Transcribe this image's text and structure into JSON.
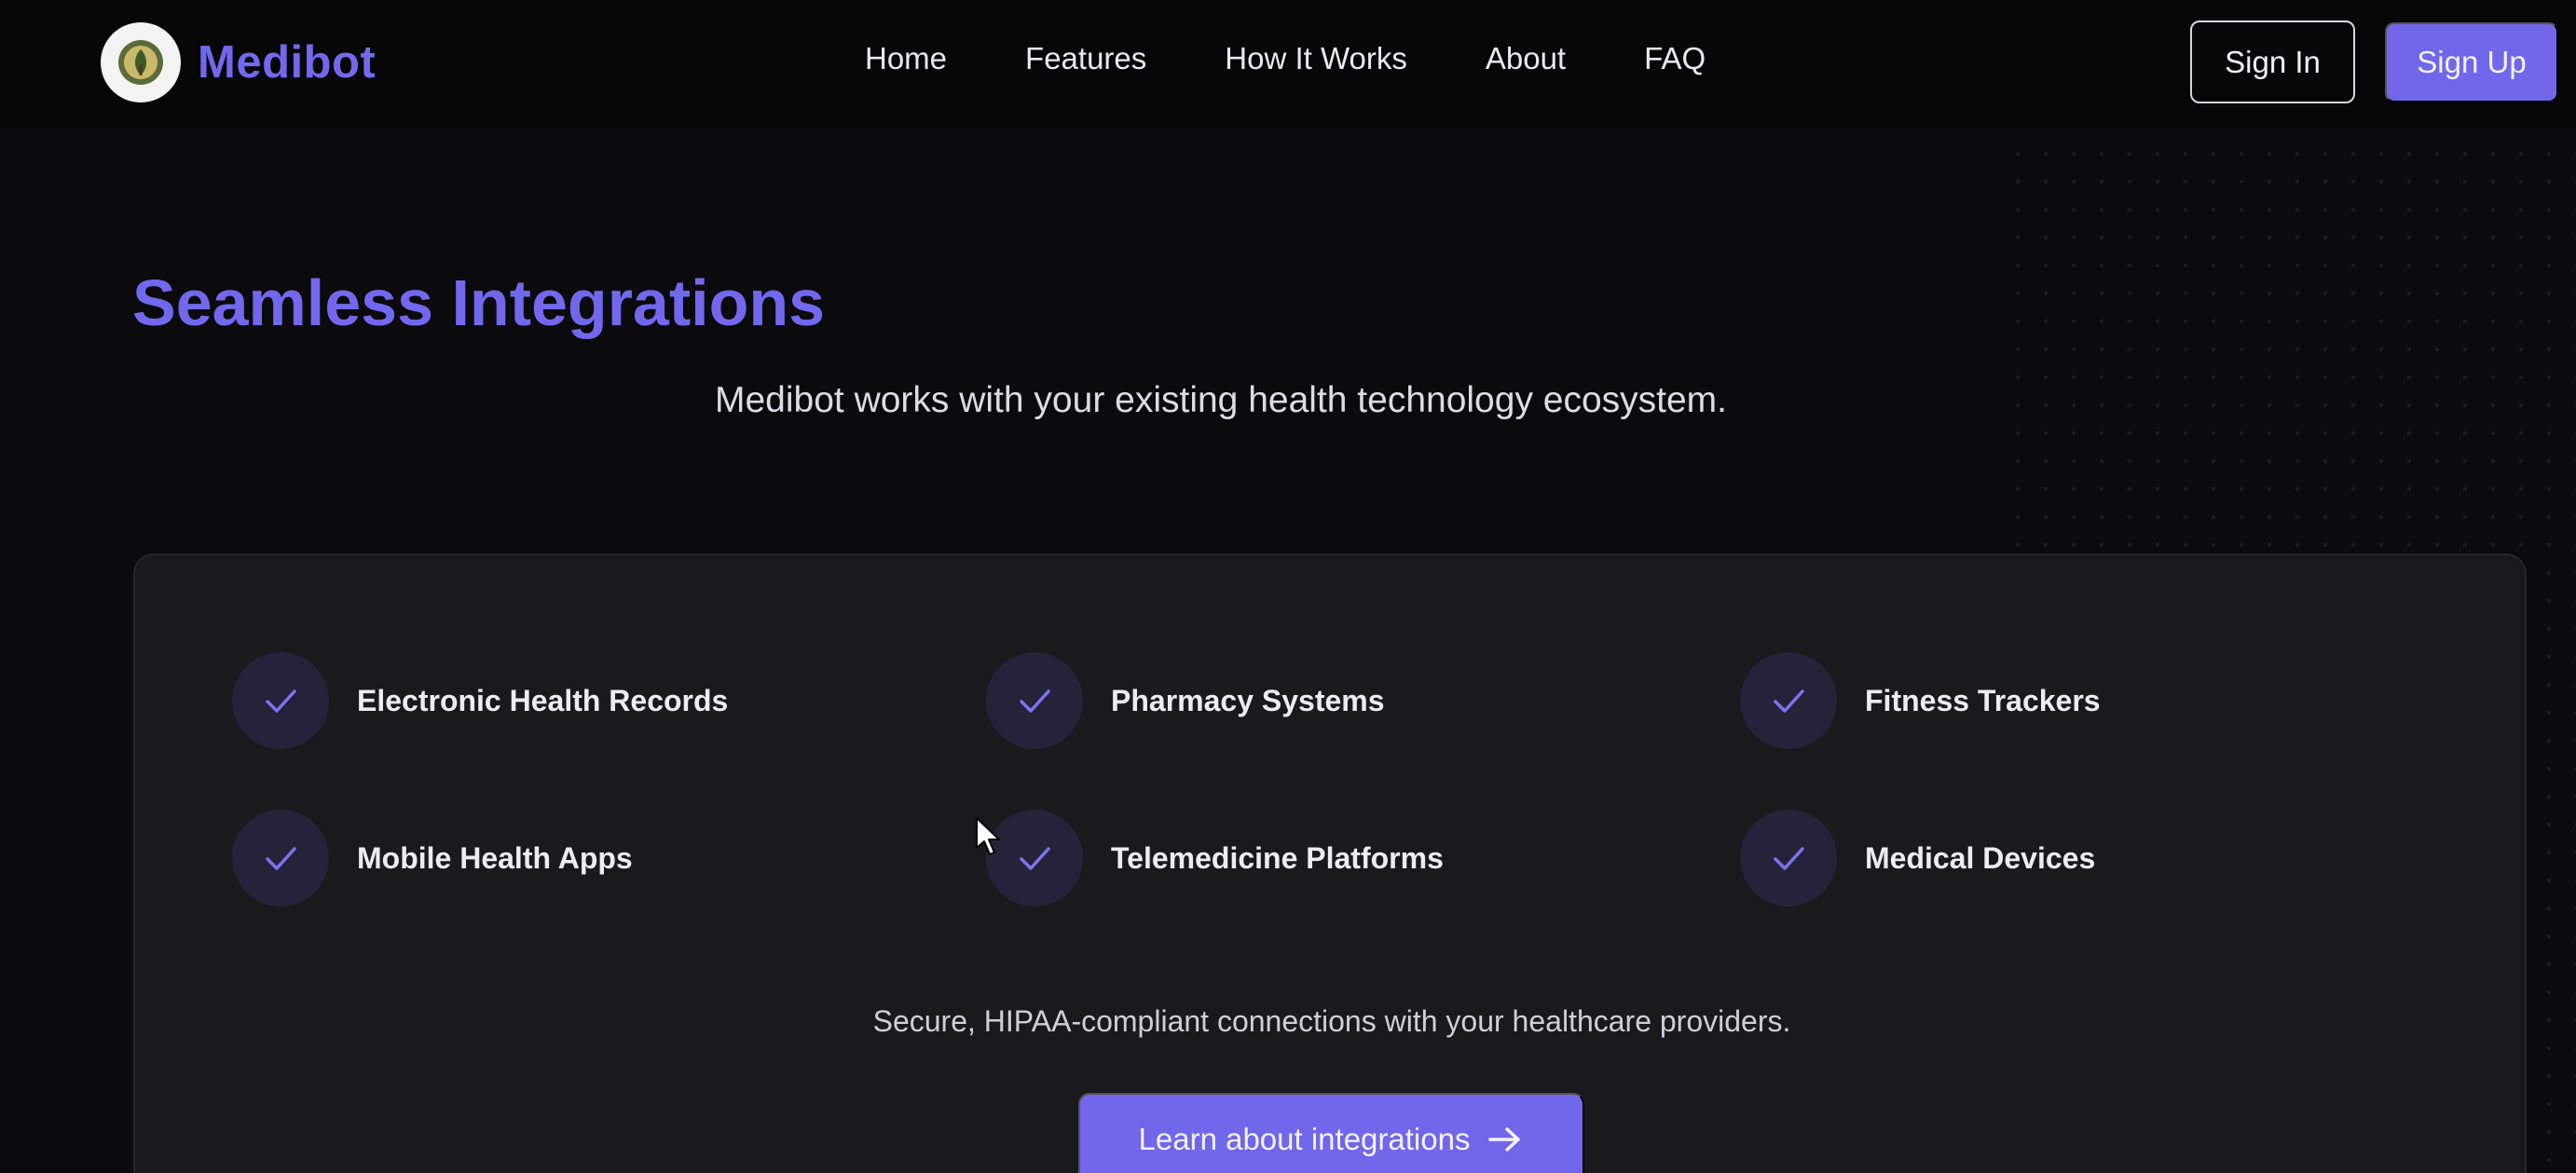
{
  "brand": {
    "name": "Medibot",
    "accent_color": "#7268ee"
  },
  "nav": {
    "links": [
      "Home",
      "Features",
      "How It Works",
      "About",
      "FAQ"
    ],
    "sign_in": "Sign In",
    "sign_up": "Sign Up"
  },
  "section": {
    "title": "Seamless Integrations",
    "subtitle": "Medibot works with your existing health technology ecosystem."
  },
  "integrations": {
    "items": [
      {
        "label": "Electronic Health Records",
        "icon": "check-icon"
      },
      {
        "label": "Pharmacy Systems",
        "icon": "check-icon"
      },
      {
        "label": "Fitness Trackers",
        "icon": "check-icon"
      },
      {
        "label": "Mobile Health Apps",
        "icon": "check-icon"
      },
      {
        "label": "Telemedicine Platforms",
        "icon": "check-icon"
      },
      {
        "label": "Medical Devices",
        "icon": "check-icon"
      }
    ],
    "note": "Secure, HIPAA-compliant connections with your healthcare providers.",
    "cta": "Learn about integrations"
  }
}
